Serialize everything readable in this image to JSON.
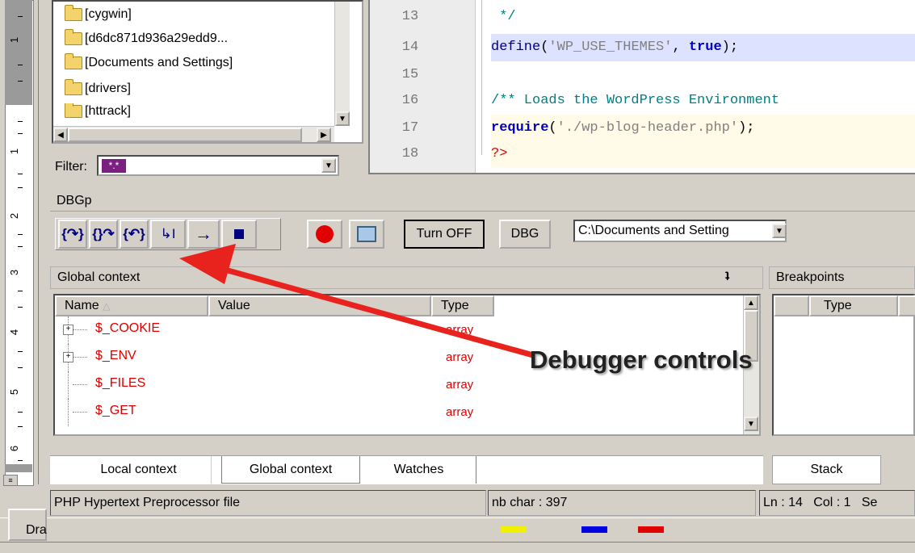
{
  "file_tree": {
    "items": [
      "[cygwin]",
      "[d6dc871d936a29edd9...",
      "[Documents and Settings]",
      "[drivers]",
      "[httrack]"
    ],
    "filter_label": "Filter:",
    "filter_value": "*.*"
  },
  "editor": {
    "lines": [
      {
        "num": "13",
        "text": " */"
      },
      {
        "num": "14",
        "func": "define",
        "open": "(",
        "arg": "'WP_USE_THEMES'",
        "sep": ", ",
        "val": "true",
        "close": ");"
      },
      {
        "num": "15",
        "text": ""
      },
      {
        "num": "16",
        "comment": "/** Loads the WordPress Environment"
      },
      {
        "num": "17",
        "func": "require",
        "open": "(",
        "arg": "'./wp-blog-header.php'",
        "close": ");"
      },
      {
        "num": "18",
        "tag": "?>"
      }
    ],
    "current_line": "14"
  },
  "dbgp": {
    "title": "DBGp",
    "buttons": {
      "step_into": "step-into-icon",
      "step_over": "step-over-icon",
      "step_out": "step-out-icon",
      "run_to_cursor": "run-to-cursor-icon",
      "run": "run-icon",
      "stop": "stop-icon",
      "breakpoint": "breakpoint-icon",
      "console": "console-icon",
      "turn_off_label": "Turn OFF",
      "dbg_label": "DBG"
    },
    "path_value": "C:\\Documents and Setting",
    "context": {
      "title": "Global context",
      "pin": "ʇ",
      "columns": [
        "Name",
        "Value",
        "Type"
      ],
      "rows": [
        {
          "name": "$_COOKIE",
          "type": "array",
          "expandable": true
        },
        {
          "name": "$_ENV",
          "type": "array",
          "expandable": true
        },
        {
          "name": "$_FILES",
          "type": "array",
          "expandable": false
        },
        {
          "name": "$_GET",
          "type": "array",
          "expandable": false
        }
      ]
    },
    "breakpoints": {
      "title": "Breakpoints",
      "columns": [
        "",
        "Type"
      ]
    },
    "tabs": [
      "Local context",
      "Global context",
      "Watches"
    ],
    "active_tab": "Global context",
    "stack_tab": "Stack"
  },
  "status_bar": {
    "file_type": "PHP Hypertext Preprocessor file",
    "chars": "nb char : 397",
    "position": "Ln : 14   Col : 1   Se"
  },
  "bottom_toolbar": {
    "draw_label": "Dra"
  },
  "annotation": {
    "label": "Debugger controls",
    "color": "#e8231e"
  },
  "ruler": {
    "numbers": [
      "1",
      "1",
      "2",
      "3",
      "4",
      "5",
      "6"
    ]
  }
}
